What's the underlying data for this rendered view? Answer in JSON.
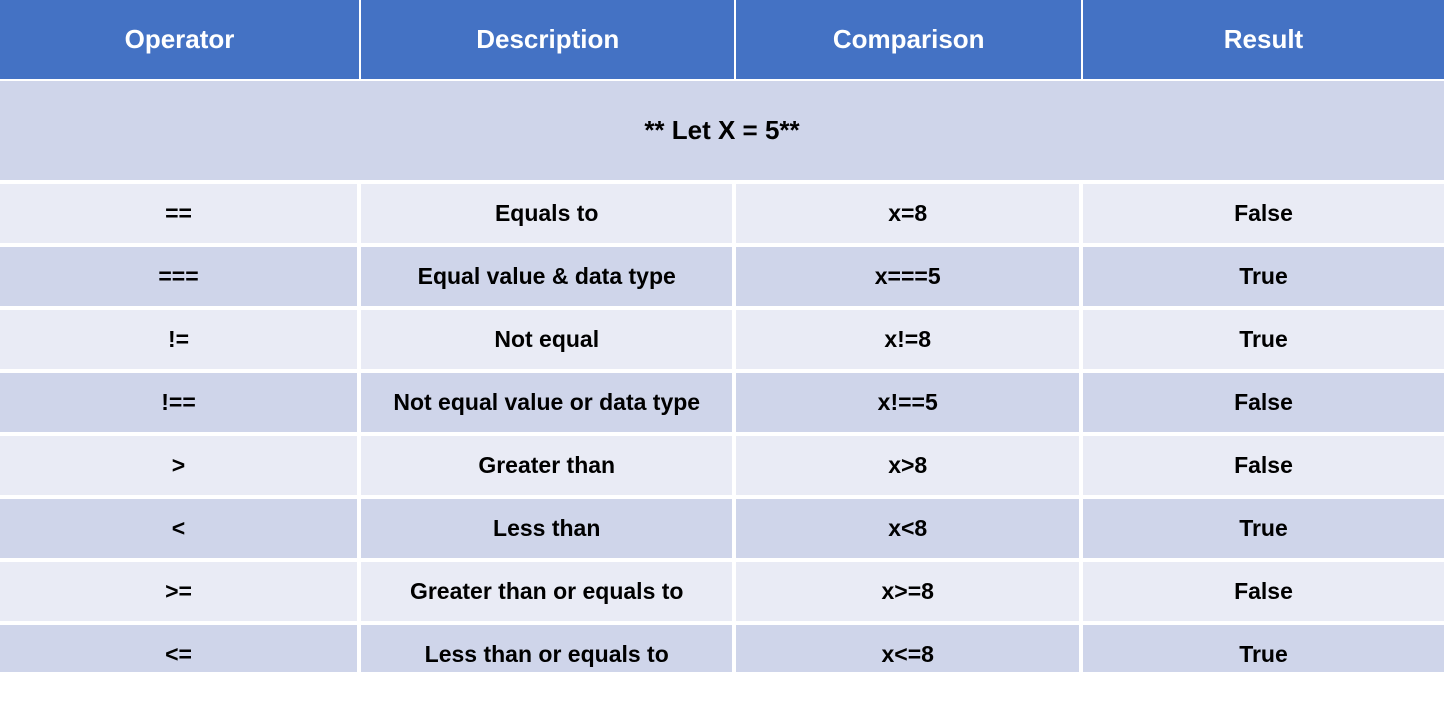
{
  "headers": {
    "operator": "Operator",
    "description": "Description",
    "comparison": "Comparison",
    "result": "Result"
  },
  "subtitle": "** Let X = 5**",
  "rows": [
    {
      "operator": "==",
      "description": "Equals to",
      "comparison": "x=8",
      "result": "False"
    },
    {
      "operator": "===",
      "description": "Equal value & data type",
      "comparison": "x===5",
      "result": "True"
    },
    {
      "operator": "!=",
      "description": "Not equal",
      "comparison": "x!=8",
      "result": "True"
    },
    {
      "operator": "!==",
      "description": "Not equal value or data type",
      "comparison": "x!==5",
      "result": "False"
    },
    {
      "operator": ">",
      "description": "Greater than",
      "comparison": "x>8",
      "result": "False"
    },
    {
      "operator": "<",
      "description": "Less than",
      "comparison": "x<8",
      "result": "True"
    },
    {
      "operator": ">=",
      "description": "Greater than or equals to",
      "comparison": "x>=8",
      "result": "False"
    },
    {
      "operator": "<=",
      "description": "Less than or equals to",
      "comparison": "x<=8",
      "result": "True"
    }
  ]
}
